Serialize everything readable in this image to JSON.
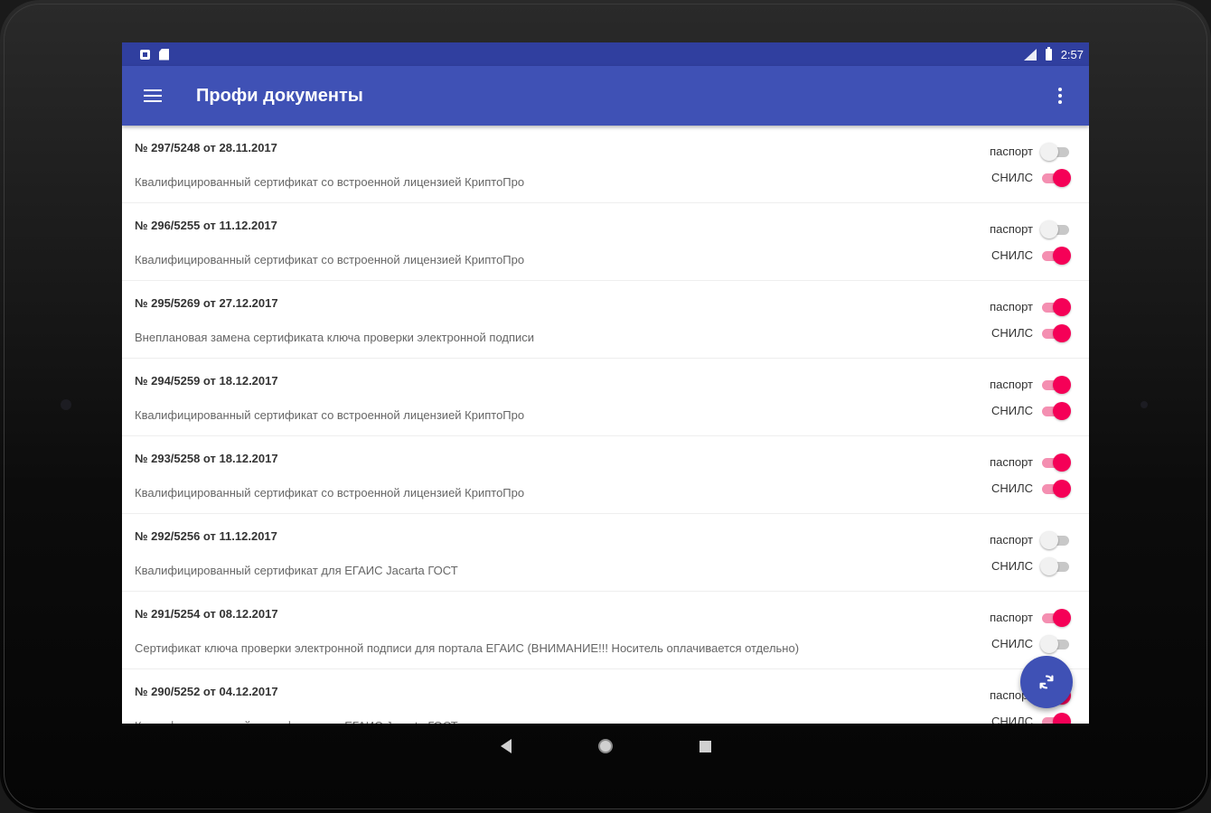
{
  "status_bar": {
    "time": "2:57"
  },
  "toolbar": {
    "title": "Профи документы"
  },
  "labels": {
    "passport": "паспорт",
    "snils": "СНИЛС"
  },
  "colors": {
    "primary": "#3f51b5",
    "primary_dark": "#303f9f",
    "accent": "#f50057"
  },
  "documents": [
    {
      "number": "№ 297/5248 от 28.11.2017",
      "description": "Квалифицированный сертификат со встроенной лицензией КриптоПро",
      "passport": false,
      "snils": true
    },
    {
      "number": "№ 296/5255 от 11.12.2017",
      "description": "Квалифицированный сертификат со встроенной лицензией КриптоПро",
      "passport": false,
      "snils": true
    },
    {
      "number": "№ 295/5269 от 27.12.2017",
      "description": "Внеплановая замена сертификата ключа проверки электронной подписи",
      "passport": true,
      "snils": true
    },
    {
      "number": "№ 294/5259 от 18.12.2017",
      "description": "Квалифицированный сертификат со встроенной лицензией КриптоПро",
      "passport": true,
      "snils": true
    },
    {
      "number": "№ 293/5258 от 18.12.2017",
      "description": "Квалифицированный сертификат со встроенной лицензией КриптоПро",
      "passport": true,
      "snils": true
    },
    {
      "number": "№ 292/5256 от 11.12.2017",
      "description": "Квалифицированный сертификат для ЕГАИС Jacarta ГОСТ",
      "passport": false,
      "snils": false
    },
    {
      "number": "№ 291/5254 от 08.12.2017",
      "description": "Сертификат ключа проверки электронной подписи для портала ЕГАИС (ВНИМАНИЕ!!! Носитель оплачивается отдельно)",
      "passport": true,
      "snils": false
    },
    {
      "number": "№ 290/5252 от 04.12.2017",
      "description": "Квалифицированный сертификат для ЕГАИС Jacarta ГОСТ",
      "passport": true,
      "snils": true
    }
  ],
  "icons": {
    "menu": "hamburger-icon",
    "more": "more-vert-icon",
    "fab": "refresh-icon"
  }
}
